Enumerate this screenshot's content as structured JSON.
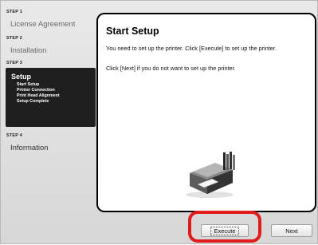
{
  "steps": [
    {
      "step": "STEP 1",
      "title": "License Agreement"
    },
    {
      "step": "STEP 2",
      "title": "Installation"
    },
    {
      "step": "STEP 3",
      "title": "Setup",
      "substeps": [
        "Start Setup",
        "Printer Connection",
        "Print Head Alignment",
        "Setup Complete"
      ]
    },
    {
      "step": "STEP 4",
      "title": "Information"
    }
  ],
  "content": {
    "title": "Start Setup",
    "paragraph1": "You need to set up the printer. Click [Execute] to set up the printer.",
    "paragraph2": "Click [Next] if you do not want to set up the printer."
  },
  "buttons": {
    "execute": "Execute",
    "next": "Next"
  },
  "colors": {
    "highlight": "#e01b1b",
    "active_step_bg": "#1f1f1f"
  }
}
